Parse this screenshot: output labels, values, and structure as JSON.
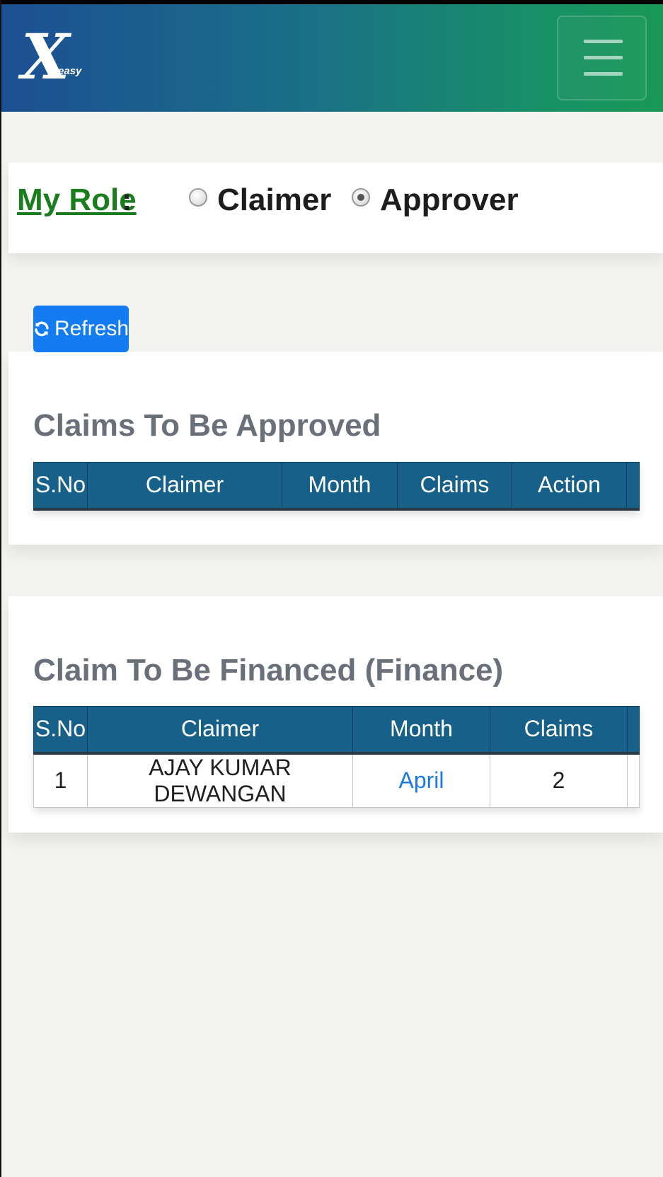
{
  "navbar": {
    "logo_mark": "X",
    "logo_text": "easy",
    "menu_icon": "hamburger-menu-icon"
  },
  "role": {
    "label": "My Role",
    "colon": ":",
    "options": [
      {
        "label": "Claimer",
        "checked": false
      },
      {
        "label": "Approver",
        "checked": true
      }
    ]
  },
  "refresh_label": "Refresh",
  "approve_section": {
    "title": "Claims To Be Approved",
    "columns": [
      "S.No",
      "Claimer",
      "Month",
      "Claims",
      "Action"
    ],
    "rows": []
  },
  "finance_section": {
    "title": "Claim To Be Financed (Finance)",
    "columns": [
      "S.No",
      "Claimer",
      "Month",
      "Claims"
    ],
    "rows": [
      {
        "sno": "1",
        "claimer": "AJAY KUMAR DEWANGAN",
        "month": "April",
        "claims": "2"
      }
    ]
  },
  "colors": {
    "nav_start": "#1c4f93",
    "nav_end": "#1a9856",
    "accent_button": "#137cf2",
    "table_header": "#16608a",
    "role_label": "#1a7d1e",
    "link": "#1a7ae6"
  }
}
